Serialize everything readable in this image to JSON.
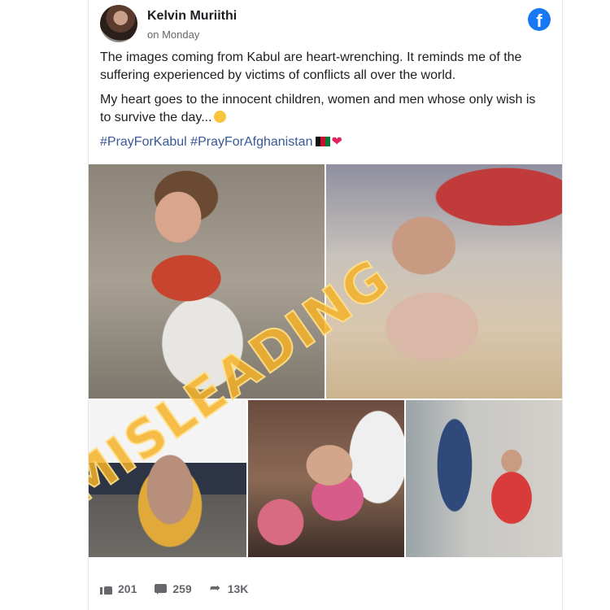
{
  "post": {
    "author": "Kelvin Muriithi",
    "time": "on Monday",
    "paragraph1": "The images coming from Kabul are heart-wrenching. It reminds me of the suffering experienced by victims of conflicts all over the world.",
    "paragraph2": "My heart goes to the innocent children, women and men whose only wish is to survive the day...",
    "hashtags": "#PrayForKabul #PrayForAfghanistan",
    "stamp_text": "MISLEADING"
  },
  "icons": {
    "platform": "facebook-icon",
    "like": "thumbs-up-icon",
    "comment": "comment-icon",
    "share": "share-arrow-icon"
  },
  "stats": {
    "likes": "201",
    "comments": "259",
    "shares": "13K"
  },
  "colors": {
    "brand": "#1877f2",
    "hashtag": "#385898",
    "stamp": "#f5b228"
  }
}
